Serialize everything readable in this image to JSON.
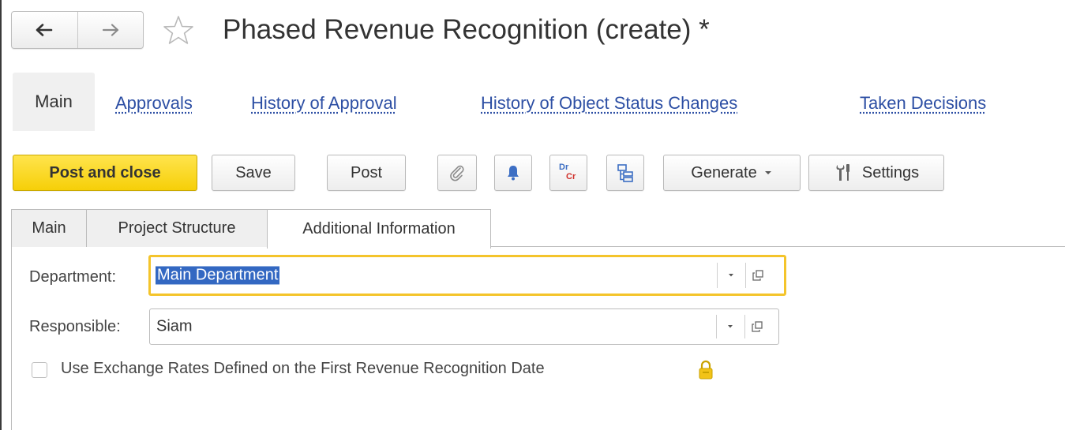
{
  "window": {
    "title": "Phased Revenue Recognition (create) *",
    "back_icon": "arrow-left-icon",
    "forward_icon": "arrow-right-icon",
    "favorite_icon": "star-outline-icon"
  },
  "sections": {
    "active": "Main",
    "links": [
      "Approvals",
      "History of Approval",
      "History of Object Status Changes",
      "Taken Decisions"
    ]
  },
  "toolbar": {
    "post_and_close": "Post and close",
    "save": "Save",
    "post": "Post",
    "attach_icon": "paperclip-icon",
    "reminder_icon": "bell-icon",
    "dr_label": "Dr",
    "cr_label": "Cr",
    "structure_icon": "document-structure-icon",
    "generate": "Generate",
    "settings": "Settings",
    "settings_icon": "wrench-screwdriver-icon"
  },
  "tabs": [
    "Main",
    "Project Structure",
    "Additional Information"
  ],
  "active_tab": "Additional Information",
  "form": {
    "department_label": "Department:",
    "department_value": "Main Department",
    "responsible_label": "Responsible:",
    "responsible_value": "Siam",
    "exchange_rates_label": "Use Exchange Rates Defined on the First Revenue Recognition Date",
    "exchange_rates_checked": false,
    "lock_icon": "padlock-icon"
  },
  "colors": {
    "accent_link": "#2d4fa4",
    "primary_button": "#f6cf08",
    "focus_border": "#f4c42b",
    "selection": "#3368c2"
  }
}
